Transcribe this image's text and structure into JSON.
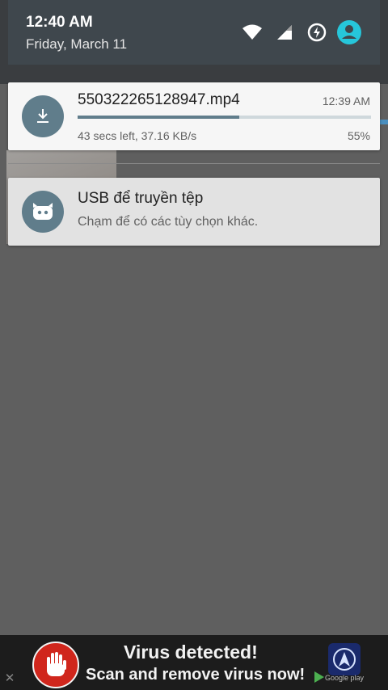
{
  "status_bar": {
    "time": "12:40 AM",
    "date": "Friday, March 11",
    "icons": [
      "wifi-icon",
      "signal-icon",
      "battery-charging-icon",
      "profile-icon"
    ]
  },
  "notifications": [
    {
      "icon": "download-icon",
      "title": "550322265128947.mp4",
      "time": "12:39 AM",
      "progress": 55,
      "detail": "43 secs left, 37.16 KB/s",
      "percent_label": "55%"
    },
    {
      "icon": "cyanogen-icon",
      "title": "USB để truyền tệp",
      "detail": "Chạm để có các tùy chọn khác."
    }
  ],
  "ad": {
    "title": "Virus detected!",
    "subtitle": "Scan and remove virus now!",
    "store_label": "Google play",
    "colors": {
      "hand_bg": "#d0261c",
      "banner_bg": "#1c1c1c"
    }
  },
  "colors": {
    "accent": "#607d8b",
    "header_bg": "#3f474d",
    "scrim": "#5f5f5f",
    "profile": "#26c6da"
  }
}
